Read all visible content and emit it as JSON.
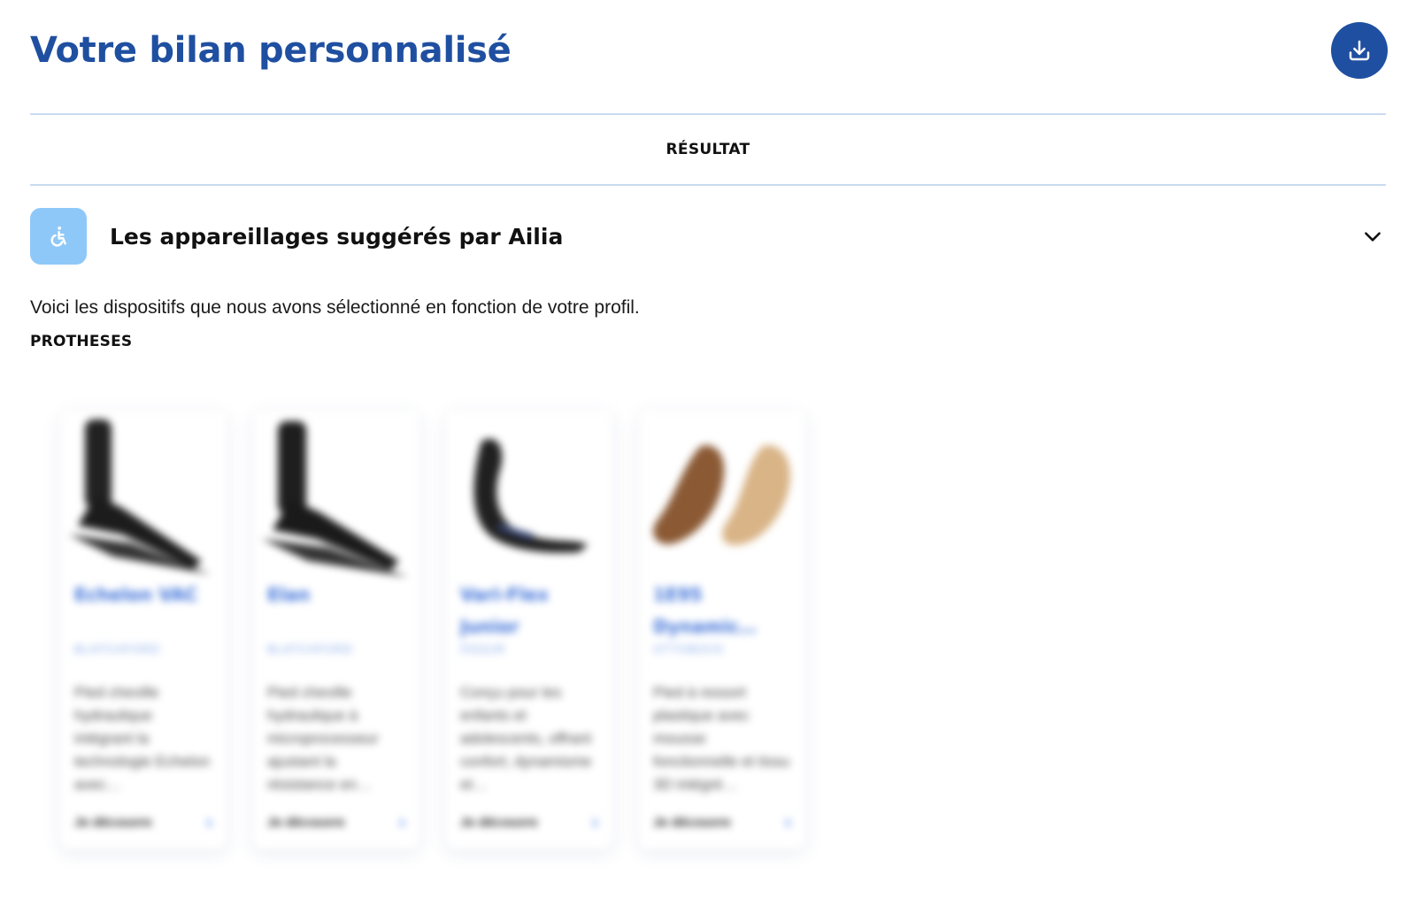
{
  "header": {
    "title": "Votre bilan personnalisé",
    "download_icon": "download-icon",
    "accent_color": "#1f4fa0"
  },
  "tabs": [
    {
      "label": "RÉSULTAT",
      "active": true
    }
  ],
  "accordion": {
    "icon": "accessibility-icon",
    "icon_bg": "#8ec8f8",
    "title": "Les appareillages suggérés par Ailia",
    "chevron_icon": "chevron-down-icon",
    "expanded": true
  },
  "intro_text": "Voici les dispositifs que nous avons sélectionné en fonction de votre profil.",
  "section_label": "PROTHESES",
  "cards": [
    {
      "name": "Echelon VAC",
      "brand": "BLATCHFORD",
      "description": "Pied cheville hydraulique intégrant la technologie Echelon avec…",
      "link_label": "Je découvre",
      "image": "prosthetic-foot-dark"
    },
    {
      "name": "Elan",
      "brand": "BLATCHFORD",
      "description": "Pied cheville hydraulique à microprocesseur ajustant la résistance en…",
      "link_label": "Je découvre",
      "image": "prosthetic-foot-dark"
    },
    {
      "name": "Vari-Flex Junior",
      "brand": "ÖSSUR",
      "description": "Conçu pour les enfants et adolescents, offrant confort, dynamisme et…",
      "link_label": "Je découvre",
      "image": "prosthetic-foot-carbon"
    },
    {
      "name": "1E95 Dynamic…",
      "brand": "OTTOBOCK",
      "description": "Pied à ressort plastique avec mousse fonctionnelle et tissu 3D intégré…",
      "link_label": "Je découvre",
      "image": "prosthetic-foot-cosmetic"
    }
  ]
}
